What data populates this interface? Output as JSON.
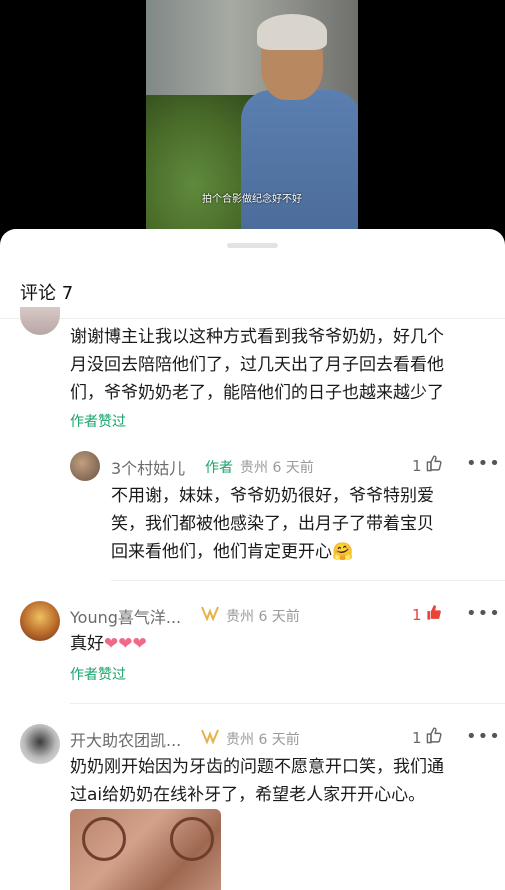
{
  "video": {
    "caption": "拍个合影做纪念好不好"
  },
  "comments_sheet": {
    "title": "评论 7",
    "comments": [
      {
        "text_lines": [
          "谢谢博主让我以这种方式看到我爷爷奶奶，好几个",
          "月没回去陪陪他们了，过几天出了月子回去看看他",
          "们，爷爷奶奶老了，能陪他们的日子也越来越少了"
        ],
        "author_liked": "作者赞过"
      },
      {
        "is_reply": true,
        "name": "3个村姑儿",
        "author_tag": "作者",
        "location_time": "贵州 6 天前",
        "likes": "1",
        "text_lines": [
          "不用谢，妹妹，爷爷奶奶很好，爷爷特别爱",
          "笑，我们都被他感染了，出月子了带着宝贝",
          "回来看他们，他们肯定更开心"
        ],
        "emoji": "🤗"
      },
      {
        "name": "Young喜气洋...",
        "location_time": "贵州 6 天前",
        "likes": "1",
        "liked_by_me": true,
        "text": "真好",
        "hearts": "❤❤❤",
        "author_liked": "作者赞过"
      },
      {
        "name": "开大助农团凯...",
        "location_time": "贵州 6 天前",
        "likes": "1",
        "text_lines": [
          "奶奶刚开始因为牙齿的问题不愿意开口笑，我们通",
          "过ai给奶奶在线补牙了，希望老人家开开心心。"
        ]
      }
    ]
  },
  "icons": {
    "thumb": "thumb-up-icon",
    "more": "more-icon",
    "badge": "fan-badge-icon"
  },
  "colors": {
    "accent_green": "#1aa36b",
    "like_red": "#e8443a"
  }
}
